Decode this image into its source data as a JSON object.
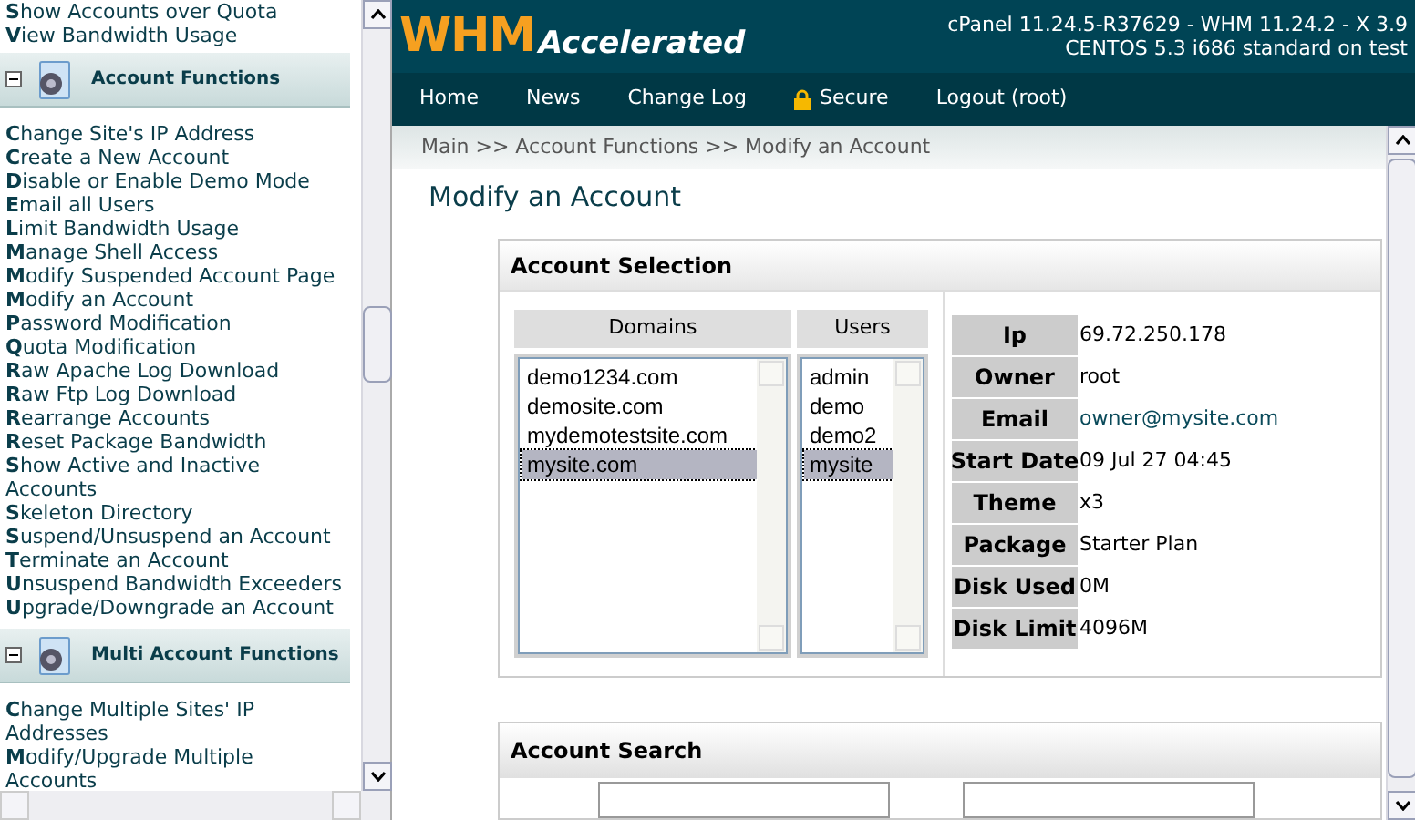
{
  "sidebar": {
    "top_links": [
      "Show Accounts over Quota",
      "View Bandwidth Usage"
    ],
    "sections": [
      {
        "title": "Account Functions",
        "expanded": true,
        "links": [
          "Change Site's IP Address",
          "Create a New Account",
          "Disable or Enable Demo Mode",
          "Email all Users",
          "Limit Bandwidth Usage",
          "Manage Shell Access",
          "Modify Suspended Account Page",
          "Modify an Account",
          "Password Modification",
          "Quota Modification",
          "Raw Apache Log Download",
          "Raw Ftp Log Download",
          "Rearrange Accounts",
          "Reset Package Bandwidth",
          "Show Active and Inactive Accounts",
          "Skeleton Directory",
          "Suspend/Unsuspend an Account",
          "Terminate an Account",
          "Unsuspend Bandwidth Exceeders",
          "Upgrade/Downgrade an Account"
        ]
      },
      {
        "title": "Multi Account Functions",
        "expanded": true,
        "links": [
          "Change Multiple Sites' IP Addresses",
          "Modify/Upgrade Multiple Accounts"
        ]
      }
    ]
  },
  "header": {
    "logo_main": "WHM",
    "logo_sub": "Accelerated",
    "version_lines": [
      "cPanel 11.24.5-R37629 - WHM 11.24.2 - X 3.9",
      "CENTOS 5.3 i686 standard on test"
    ]
  },
  "nav": [
    {
      "label": "Home",
      "kind": "plain"
    },
    {
      "label": "News",
      "kind": "plain"
    },
    {
      "label": "Change Log",
      "kind": "plain"
    },
    {
      "label": "Secure",
      "kind": "lock"
    },
    {
      "label": "Logout (root)",
      "kind": "plain"
    }
  ],
  "breadcrumb": "Main >> Account Functions >> Modify an Account",
  "page_title": "Modify an Account",
  "account_selection": {
    "title": "Account Selection",
    "domains": {
      "heading": "Domains",
      "items": [
        {
          "label": "demo1234.com",
          "selected": false
        },
        {
          "label": "demosite.com",
          "selected": false
        },
        {
          "label": "mydemotestsite.com",
          "selected": false
        },
        {
          "label": "mysite.com",
          "selected": true
        }
      ]
    },
    "users": {
      "heading": "Users",
      "items": [
        {
          "label": "admin",
          "selected": false
        },
        {
          "label": "demo",
          "selected": false
        },
        {
          "label": "demo2",
          "selected": false
        },
        {
          "label": "mysite",
          "selected": true
        }
      ]
    },
    "details": [
      {
        "label": "Ip",
        "value": "69.72.250.178",
        "kind": "text"
      },
      {
        "label": "Owner",
        "value": "root",
        "kind": "text"
      },
      {
        "label": "Email",
        "value": "owner@mysite.com",
        "kind": "link"
      },
      {
        "label": "Start Date",
        "value": "09 Jul 27 04:45",
        "kind": "text"
      },
      {
        "label": "Theme",
        "value": "x3",
        "kind": "text"
      },
      {
        "label": "Package",
        "value": "Starter Plan",
        "kind": "text"
      },
      {
        "label": "Disk Used",
        "value": "0M",
        "kind": "text"
      },
      {
        "label": "Disk Limit",
        "value": "4096M",
        "kind": "text"
      }
    ]
  },
  "account_search": {
    "title": "Account Search"
  }
}
